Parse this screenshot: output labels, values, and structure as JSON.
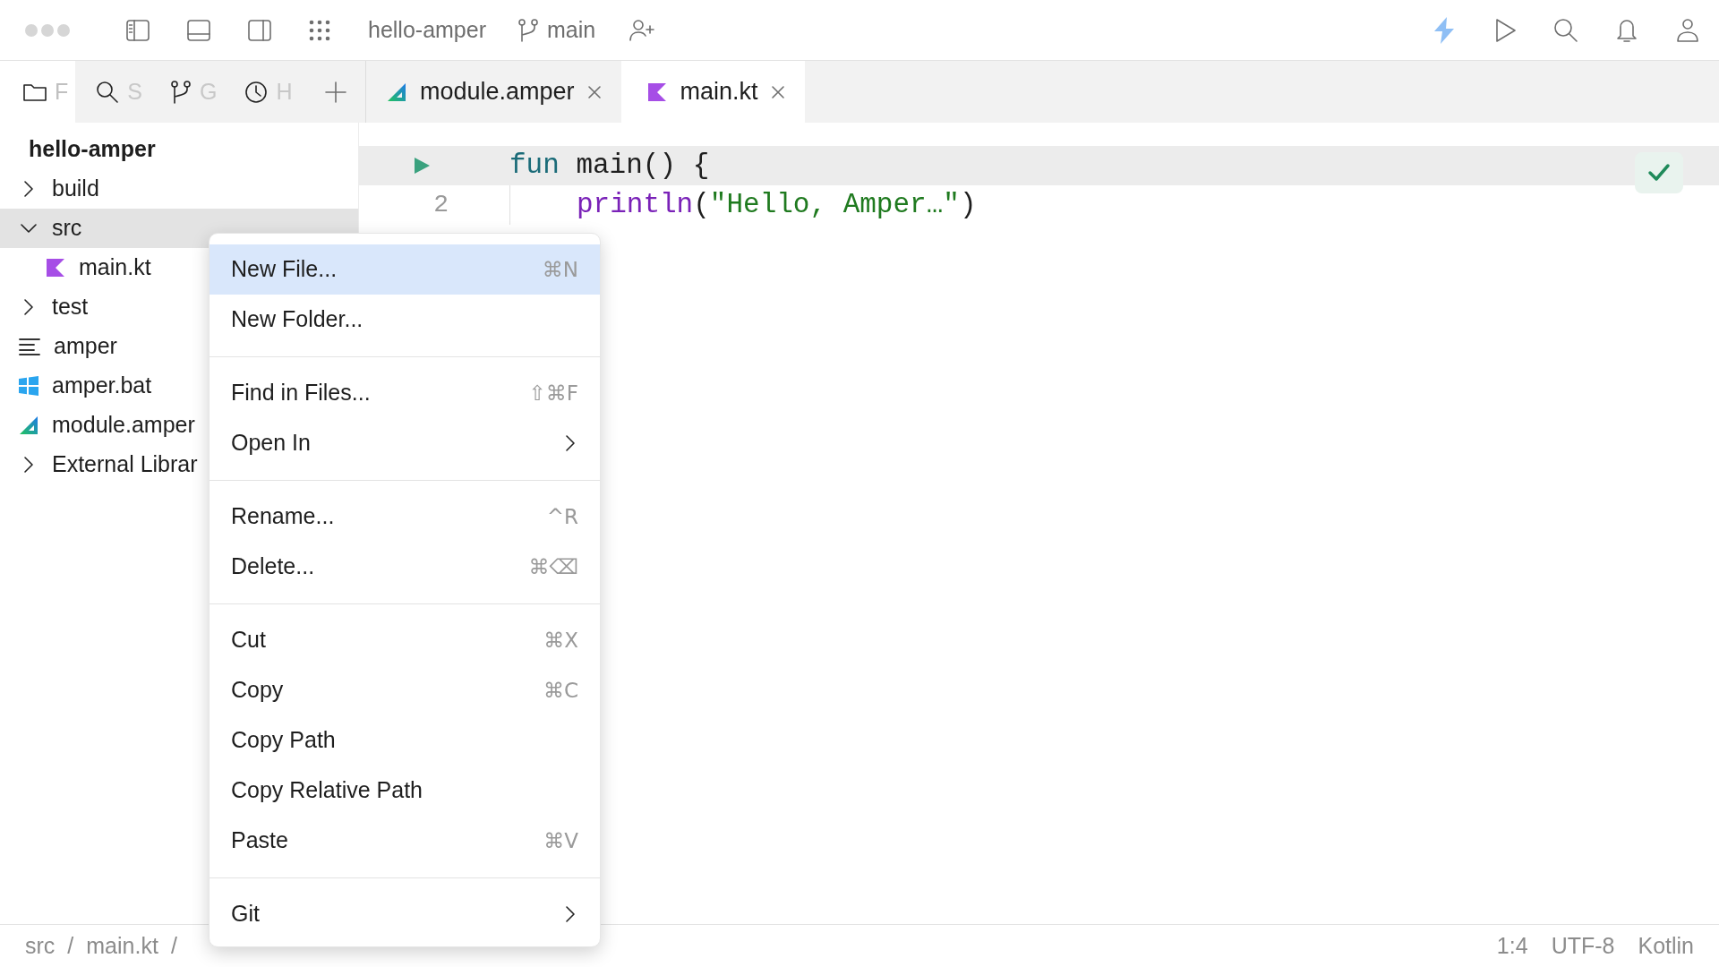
{
  "title_bar": {
    "project": "hello-amper",
    "branch": "main"
  },
  "tool_tabs": [
    {
      "label": "F",
      "kind": "folder",
      "selected": true
    },
    {
      "label": "S",
      "kind": "search",
      "selected": false
    },
    {
      "label": "G",
      "kind": "branch",
      "selected": false
    },
    {
      "label": "H",
      "kind": "clock",
      "selected": false
    }
  ],
  "editor_tabs": [
    {
      "label": "module.amper",
      "kind": "amper",
      "selected": false
    },
    {
      "label": "main.kt",
      "kind": "kotlin",
      "selected": true
    }
  ],
  "project_tree": {
    "title": "hello-amper",
    "items": [
      {
        "label": "build",
        "kind": "folder",
        "expanded": false,
        "selected": false
      },
      {
        "label": "src",
        "kind": "folder",
        "expanded": true,
        "selected": true,
        "children": [
          {
            "label": "main.kt",
            "kind": "kotlin",
            "selected": false
          }
        ]
      },
      {
        "label": "test",
        "kind": "folder",
        "expanded": false,
        "selected": false
      },
      {
        "label": "amper",
        "kind": "script",
        "selected": false
      },
      {
        "label": "amper.bat",
        "kind": "windows",
        "selected": false
      },
      {
        "label": "module.amper",
        "kind": "amper",
        "selected": false
      },
      {
        "label": "External Librar",
        "kind": "folder",
        "expanded": false,
        "selected": false
      }
    ]
  },
  "editor": {
    "lines": [
      {
        "kind": "run",
        "current": true,
        "indented": false,
        "tokens": [
          {
            "text": "fun",
            "kind": "keyword"
          },
          {
            "text": " main() {",
            "kind": "plain"
          }
        ]
      },
      {
        "kind": "numbered",
        "number": "2",
        "current": false,
        "indented": true,
        "tokens": [
          {
            "text": "println",
            "kind": "function"
          },
          {
            "text": "(",
            "kind": "plain"
          },
          {
            "text": "\"Hello, Amper…\"",
            "kind": "string"
          },
          {
            "text": ")",
            "kind": "plain"
          }
        ]
      }
    ]
  },
  "context_menu": {
    "sections": [
      [
        {
          "label": "New File...",
          "shortcut": "⌘N",
          "submenu": false,
          "selected": true
        },
        {
          "label": "New Folder...",
          "submenu": false,
          "selected": false
        }
      ],
      [
        {
          "label": "Find in Files...",
          "shortcut": "⇧⌘F",
          "submenu": false,
          "selected": false
        },
        {
          "label": "Open In",
          "submenu": true,
          "selected": false
        }
      ],
      [
        {
          "label": "Rename...",
          "shortcut": "^R",
          "submenu": false,
          "selected": false
        },
        {
          "label": "Delete...",
          "shortcut": "⌘⌫",
          "submenu": false,
          "selected": false
        }
      ],
      [
        {
          "label": "Cut",
          "shortcut": "⌘X",
          "submenu": false,
          "selected": false
        },
        {
          "label": "Copy",
          "shortcut": "⌘C",
          "submenu": false,
          "selected": false
        },
        {
          "label": "Copy Path",
          "submenu": false,
          "selected": false
        },
        {
          "label": "Copy Relative Path",
          "submenu": false,
          "selected": false
        },
        {
          "label": "Paste",
          "shortcut": "⌘V",
          "submenu": false,
          "selected": false
        }
      ],
      [
        {
          "label": "Git",
          "submenu": true,
          "selected": false
        }
      ]
    ]
  },
  "status_bar": {
    "breadcrumbs": [
      {
        "text": "src",
        "kind": "crumb"
      },
      {
        "text": "/",
        "kind": "separator"
      },
      {
        "text": "main.kt",
        "kind": "crumb"
      },
      {
        "text": "/",
        "kind": "separator"
      }
    ],
    "position": "1:4",
    "encoding": "UTF-8",
    "language": "Kotlin"
  }
}
